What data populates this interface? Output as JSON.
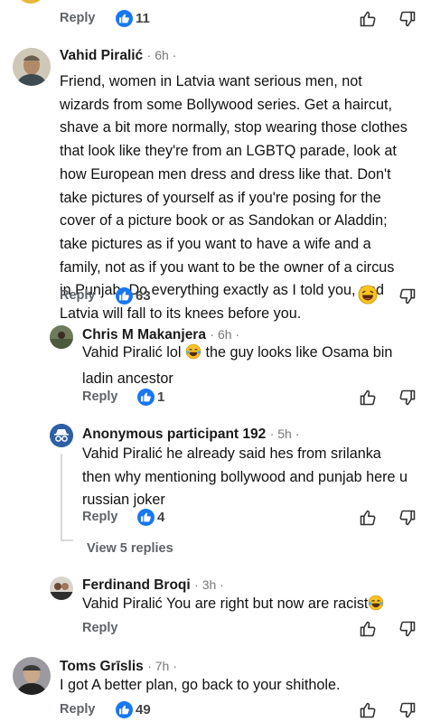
{
  "top": {
    "reply_label": "Reply",
    "likes": "11"
  },
  "comments": [
    {
      "author": "Vahid Piralić",
      "time": "· 6h ·",
      "lines": [
        "Friend, women in Latvia want serious men, not",
        "wizards from some Bollywood series. Get a haircut,",
        "shave a bit more normally, stop wearing those clothes",
        "that look like they're from an LGBTQ parade, look at",
        "how European men dress and dress like that. Don't",
        "take pictures of yourself as if you're posing for the",
        "cover of a picture book or as Sandokan or Aladdin;",
        "take pictures as if you want to have a wife and a",
        "family, not as if you want to be the owner of a circus",
        "in Punjab. Do everything exactly as I told you, and",
        "Latvia will fall to its knees before you."
      ],
      "reply_label": "Reply",
      "likes": "63",
      "reaction": "laughing-face"
    },
    {
      "author": "Chris M Makanjera",
      "time": "· 6h ·",
      "line1_before_emoji": "Vahid Piralić lol",
      "line1_after_emoji": " the guy looks like Osama bin",
      "line2": "ladin ancestor",
      "reply_label": "Reply",
      "likes": "1"
    },
    {
      "author": "Anonymous participant 192",
      "time": "· 5h ·",
      "lines": [
        "Vahid Piralić he already said hes from srilanka",
        "then why mentioning bollywood and punjab here u",
        "russian joker"
      ],
      "reply_label": "Reply",
      "likes": "4",
      "view_replies": "View 5 replies"
    },
    {
      "author": "Ferdinand Broqi",
      "time": "· 3h ·",
      "text": "Vahid Piralić You are right but now are racist",
      "reply_label": "Reply"
    },
    {
      "author": "Toms Grīslis",
      "time": "· 7h ·",
      "text": "I got A better plan, go back to your shithole.",
      "reply_label": "Reply",
      "likes": "49"
    }
  ],
  "colors": {
    "like_blue": "#1877f2",
    "meta_gray": "#777777",
    "thread_line": "#d8d8d8"
  }
}
